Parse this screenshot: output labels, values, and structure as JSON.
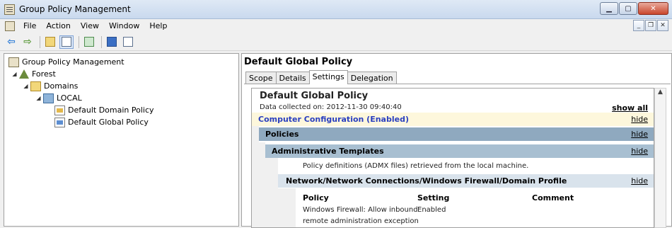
{
  "window": {
    "title": "Group Policy Management",
    "controls": {
      "minimize": "▁",
      "maximize": "▢",
      "close": "✕"
    }
  },
  "menu": {
    "items": [
      "File",
      "Action",
      "View",
      "Window",
      "Help"
    ],
    "mdi_controls": {
      "minimize": "_",
      "restore": "❐",
      "close": "✕"
    }
  },
  "toolbar": {
    "back": "⇦",
    "forward": "⇨"
  },
  "tree": {
    "root": "Group Policy Management",
    "forest": "Forest",
    "domains": "Domains",
    "local": "LOCAL",
    "gpo1": "Default Domain Policy",
    "gpo2": "Default Global Policy"
  },
  "details": {
    "title": "Default Global Policy",
    "tabs": [
      "Scope",
      "Details",
      "Settings",
      "Delegation"
    ],
    "active_tab": "Settings"
  },
  "report": {
    "title": "Default Global Policy",
    "collected": "Data collected on: 2012-11-30 09:40:40",
    "show_all": "show all",
    "hide": "hide",
    "computer_config": "Computer Configuration (Enabled)",
    "policies": "Policies",
    "admin_templates": "Administrative Templates",
    "admx_note": "Policy definitions (ADMX files) retrieved from the local machine.",
    "network_path": "Network/Network Connections/Windows Firewall/Domain Profile",
    "columns": {
      "policy": "Policy",
      "setting": "Setting",
      "comment": "Comment"
    },
    "rows": [
      {
        "policy_line1": "Windows Firewall: Allow inbound",
        "policy_line2": "remote administration exception",
        "setting": "Enabled",
        "comment": ""
      }
    ]
  }
}
